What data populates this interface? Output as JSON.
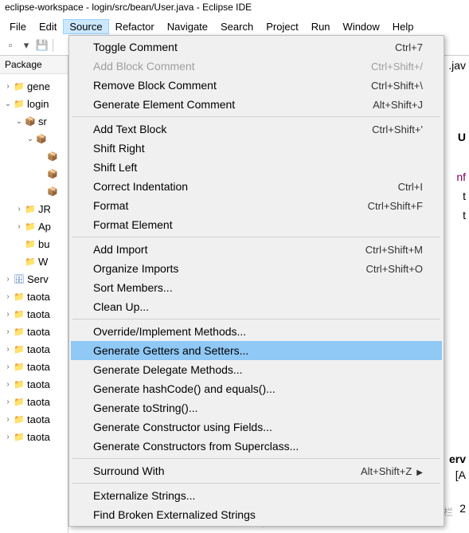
{
  "window": {
    "title": "eclipse-workspace - login/src/bean/User.java - Eclipse IDE"
  },
  "menubar": {
    "items": [
      "File",
      "Edit",
      "Source",
      "Refactor",
      "Navigate",
      "Search",
      "Project",
      "Run",
      "Window",
      "Help"
    ],
    "open_index": 2
  },
  "sidebar": {
    "title": "Package",
    "tree": [
      {
        "depth": 0,
        "tw": "›",
        "icon": "folder",
        "label": "gene"
      },
      {
        "depth": 0,
        "tw": "⌄",
        "icon": "folder",
        "label": "login"
      },
      {
        "depth": 1,
        "tw": "⌄",
        "icon": "pkg",
        "label": "sr"
      },
      {
        "depth": 2,
        "tw": "⌄",
        "icon": "pkg",
        "label": ""
      },
      {
        "depth": 3,
        "tw": "",
        "icon": "pkg",
        "label": ""
      },
      {
        "depth": 3,
        "tw": "",
        "icon": "pkg",
        "label": ""
      },
      {
        "depth": 3,
        "tw": "",
        "icon": "pkg",
        "label": ""
      },
      {
        "depth": 1,
        "tw": "›",
        "icon": "folder",
        "label": "JR"
      },
      {
        "depth": 1,
        "tw": "›",
        "icon": "folder",
        "label": "Ap"
      },
      {
        "depth": 1,
        "tw": "",
        "icon": "folder",
        "label": "bu"
      },
      {
        "depth": 1,
        "tw": "",
        "icon": "folder",
        "label": "W"
      },
      {
        "depth": 0,
        "tw": "›",
        "icon": "srv",
        "label": "Serv"
      },
      {
        "depth": 0,
        "tw": "›",
        "icon": "folder",
        "label": "taota"
      },
      {
        "depth": 0,
        "tw": "›",
        "icon": "folder",
        "label": "taota"
      },
      {
        "depth": 0,
        "tw": "›",
        "icon": "folder",
        "label": "taota"
      },
      {
        "depth": 0,
        "tw": "›",
        "icon": "folder",
        "label": "taota"
      },
      {
        "depth": 0,
        "tw": "›",
        "icon": "folder",
        "label": "taota"
      },
      {
        "depth": 0,
        "tw": "›",
        "icon": "folder",
        "label": "taota"
      },
      {
        "depth": 0,
        "tw": "›",
        "icon": "folder",
        "label": "taota"
      },
      {
        "depth": 0,
        "tw": "›",
        "icon": "folder",
        "label": "taota"
      },
      {
        "depth": 0,
        "tw": "›",
        "icon": "folder",
        "label": "taota"
      }
    ]
  },
  "source_menu": [
    {
      "label": "Toggle Comment",
      "shortcut": "Ctrl+7"
    },
    {
      "label": "Add Block Comment",
      "shortcut": "Ctrl+Shift+/",
      "disabled": true
    },
    {
      "label": "Remove Block Comment",
      "shortcut": "Ctrl+Shift+\\"
    },
    {
      "label": "Generate Element Comment",
      "shortcut": "Alt+Shift+J"
    },
    {
      "sep": true
    },
    {
      "label": "Add Text Block",
      "shortcut": "Ctrl+Shift+'"
    },
    {
      "label": "Shift Right",
      "shortcut": ""
    },
    {
      "label": "Shift Left",
      "shortcut": ""
    },
    {
      "label": "Correct Indentation",
      "shortcut": "Ctrl+I"
    },
    {
      "label": "Format",
      "shortcut": "Ctrl+Shift+F"
    },
    {
      "label": "Format Element",
      "shortcut": ""
    },
    {
      "sep": true
    },
    {
      "label": "Add Import",
      "shortcut": "Ctrl+Shift+M"
    },
    {
      "label": "Organize Imports",
      "shortcut": "Ctrl+Shift+O"
    },
    {
      "label": "Sort Members...",
      "shortcut": ""
    },
    {
      "label": "Clean Up...",
      "shortcut": ""
    },
    {
      "sep": true
    },
    {
      "label": "Override/Implement Methods...",
      "shortcut": ""
    },
    {
      "label": "Generate Getters and Setters...",
      "shortcut": "",
      "highlighted": true
    },
    {
      "label": "Generate Delegate Methods...",
      "shortcut": ""
    },
    {
      "label": "Generate hashCode() and equals()...",
      "shortcut": ""
    },
    {
      "label": "Generate toString()...",
      "shortcut": ""
    },
    {
      "label": "Generate Constructor using Fields...",
      "shortcut": ""
    },
    {
      "label": "Generate Constructors from Superclass...",
      "shortcut": ""
    },
    {
      "sep": true
    },
    {
      "label": "Surround With",
      "shortcut": "Alt+Shift+Z",
      "submenu": true
    },
    {
      "sep": true
    },
    {
      "label": "Externalize Strings...",
      "shortcut": ""
    },
    {
      "label": "Find Broken Externalized Strings",
      "shortcut": ""
    }
  ],
  "editor_fragments": {
    "r1": ".jav",
    "r2": "U",
    "r3": "nf",
    "r4": "t",
    "r5": "t",
    "r6": "erv",
    "r7": "[A",
    "r8": "2"
  },
  "watermarks": {
    "w1": "https://blog.csdn@51CTO博客",
    "w2": "新工技术专栏"
  }
}
